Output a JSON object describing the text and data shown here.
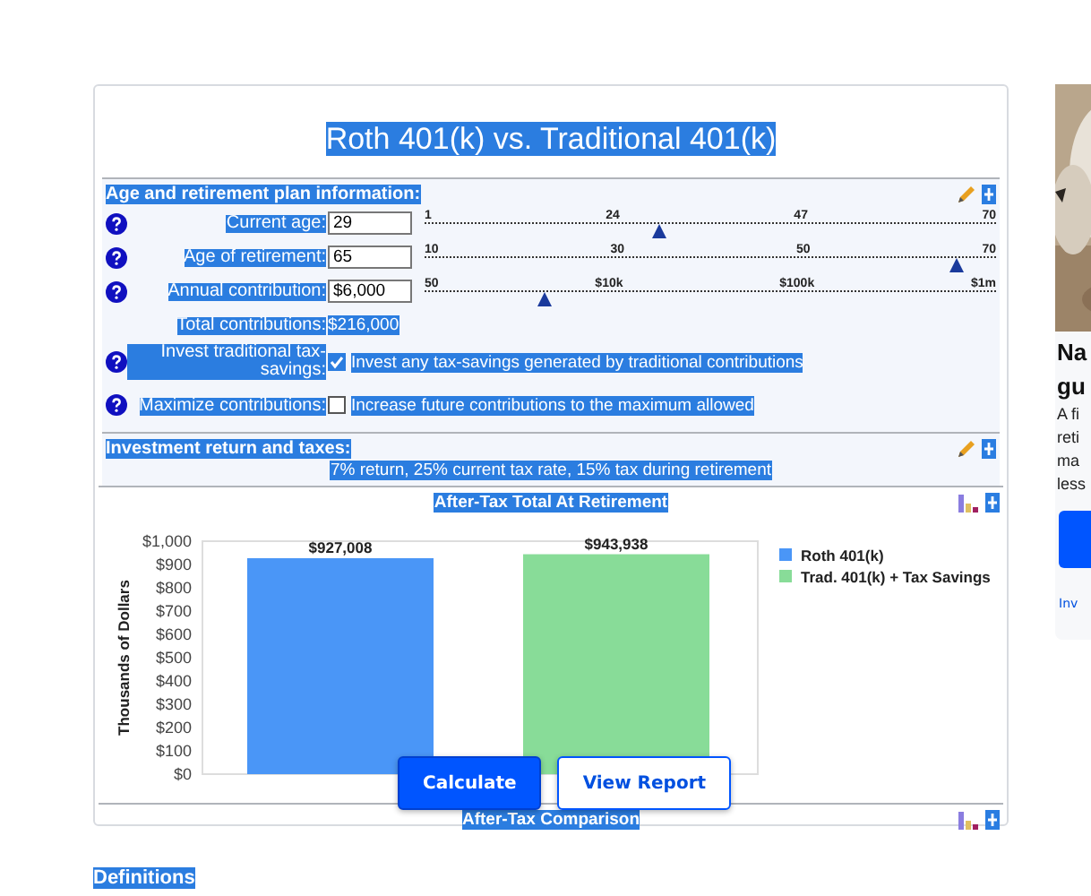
{
  "title": "Roth 401(k) vs. Traditional 401(k)",
  "sections": [
    {
      "heading": "Age and retirement plan information:",
      "rows": [
        {
          "kind": "slider",
          "label": "Current age:",
          "value": "29",
          "ticks": [
            "1",
            "24",
            "47",
            "70"
          ],
          "level": 0.41
        },
        {
          "kind": "slider",
          "label": "Age of retirement:",
          "value": "65",
          "ticks": [
            "10",
            "30",
            "50",
            "70"
          ],
          "level": 0.93
        },
        {
          "kind": "slider",
          "label": "Annual contribution:",
          "value": "$6,000",
          "ticks": [
            "50",
            "$10k",
            "$100k",
            "$1m"
          ],
          "level": 0.21
        },
        {
          "kind": "readout",
          "label": "Total contributions:",
          "value": "$216,000"
        },
        {
          "kind": "checkbox",
          "label": "Invest traditional tax-savings:",
          "checked": true,
          "description": "Invest any tax-savings generated by traditional contributions"
        },
        {
          "kind": "checkbox",
          "label": "Maximize contributions:",
          "checked": false,
          "description": "Increase future contributions to the maximum allowed"
        }
      ]
    },
    {
      "heading": "Investment return and taxes:",
      "summary": "7% return, 25% current tax rate, 15% tax during retirement"
    }
  ],
  "chart": {
    "title": "After-Tax Total At Retirement",
    "chart_data": {
      "type": "bar",
      "ylabel": "Thousands of Dollars",
      "legend": true,
      "ylim": [
        0,
        1000
      ],
      "yticks": [
        {
          "value": 0,
          "label": "$0"
        },
        {
          "value": 100,
          "label": "$100"
        },
        {
          "value": 200,
          "label": "$200"
        },
        {
          "value": 300,
          "label": "$300"
        },
        {
          "value": 400,
          "label": "$400"
        },
        {
          "value": 500,
          "label": "$500"
        },
        {
          "value": 600,
          "label": "$600"
        },
        {
          "value": 700,
          "label": "$700"
        },
        {
          "value": 800,
          "label": "$800"
        },
        {
          "value": 900,
          "label": "$900"
        },
        {
          "value": 1000,
          "label": "$1,000"
        }
      ],
      "series": [
        {
          "name": "Roth 401(k)",
          "color": "#4a96f7",
          "values": [
            927
          ]
        },
        {
          "name": "Trad. 401(k) + Tax Savings",
          "color": "#88dc98",
          "values": [
            944
          ]
        }
      ],
      "value_labels": [
        "$927,008",
        "$943,938"
      ]
    }
  },
  "next_chart_title": "After-Tax Comparison",
  "buttons": [
    {
      "label": "Calculate",
      "kind": "primary"
    },
    {
      "label": "View Report",
      "kind": "secondary"
    }
  ],
  "definitions": "Definitions",
  "side_card": {
    "lines": [
      "Na",
      "gu"
    ],
    "body": [
      "A fi",
      "reti",
      "ma",
      "less"
    ],
    "link": "Inv"
  }
}
